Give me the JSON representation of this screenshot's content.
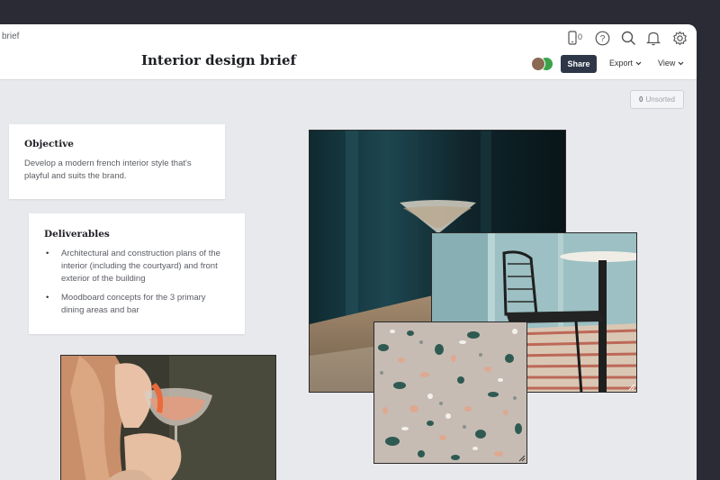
{
  "header": {
    "breadcrumb": "brief",
    "title": "Interior design brief",
    "device_count": "0",
    "share_label": "Share",
    "export_label": "Export",
    "view_label": "View"
  },
  "canvas": {
    "unsorted_count": "0",
    "unsorted_label": "Unsorted"
  },
  "objective": {
    "heading": "Objective",
    "body": "Develop a modern french interior style that's playful and suits the brand."
  },
  "deliverables": {
    "heading": "Deliverables",
    "items": [
      "Architectural and construction plans of the interior (including the courtyard) and front exterior of the building",
      "Moodboard concepts for the 3 primary dining areas and bar"
    ]
  },
  "images": [
    {
      "subject": "martini-glass-photo"
    },
    {
      "subject": "chair-table-photo"
    },
    {
      "subject": "terrazzo-texture-photo"
    },
    {
      "subject": "woman-drinking-photo"
    }
  ],
  "colors": {
    "canvas_bg": "#e8e9ec",
    "share_button": "#2d3748",
    "page_bg": "#2b2b36"
  }
}
